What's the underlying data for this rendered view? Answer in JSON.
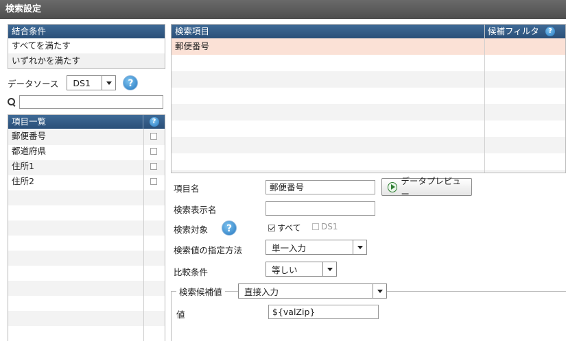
{
  "window": {
    "title": "検索設定"
  },
  "join": {
    "header": "結合条件",
    "options": [
      "すべてを満たす",
      "いずれかを満たす"
    ]
  },
  "datasource": {
    "label": "データソース",
    "selected": "DS1"
  },
  "search": {
    "value": "",
    "placeholder": ""
  },
  "field_list": {
    "header": "項目一覧",
    "items": [
      {
        "name": "郵便番号",
        "checked": false
      },
      {
        "name": "都道府県",
        "checked": false
      },
      {
        "name": "住所1",
        "checked": false
      },
      {
        "name": "住所2",
        "checked": false
      }
    ]
  },
  "search_items": {
    "col_item": "検索項目",
    "col_filter": "候補フィルタ",
    "rows": [
      {
        "item": "郵便番号",
        "filter": ""
      }
    ]
  },
  "form": {
    "item_name_label": "項目名",
    "item_name_value": "郵便番号",
    "preview_button": "データプレビュー",
    "display_name_label": "検索表示名",
    "display_name_value": "",
    "target_label": "検索対象",
    "target_all": "すべて",
    "target_ds": "DS1",
    "method_label": "検索値の指定方法",
    "method_value": "単一入力",
    "compare_label": "比較条件",
    "compare_value": "等しい",
    "candidate_label": "検索候補値",
    "candidate_value": "直接入力",
    "value_label": "値",
    "value_value": "${valZip}"
  },
  "colors": {
    "header_bg": "#2e5580",
    "selected_row": "#fbe1d6",
    "titlebar": "#555555"
  }
}
